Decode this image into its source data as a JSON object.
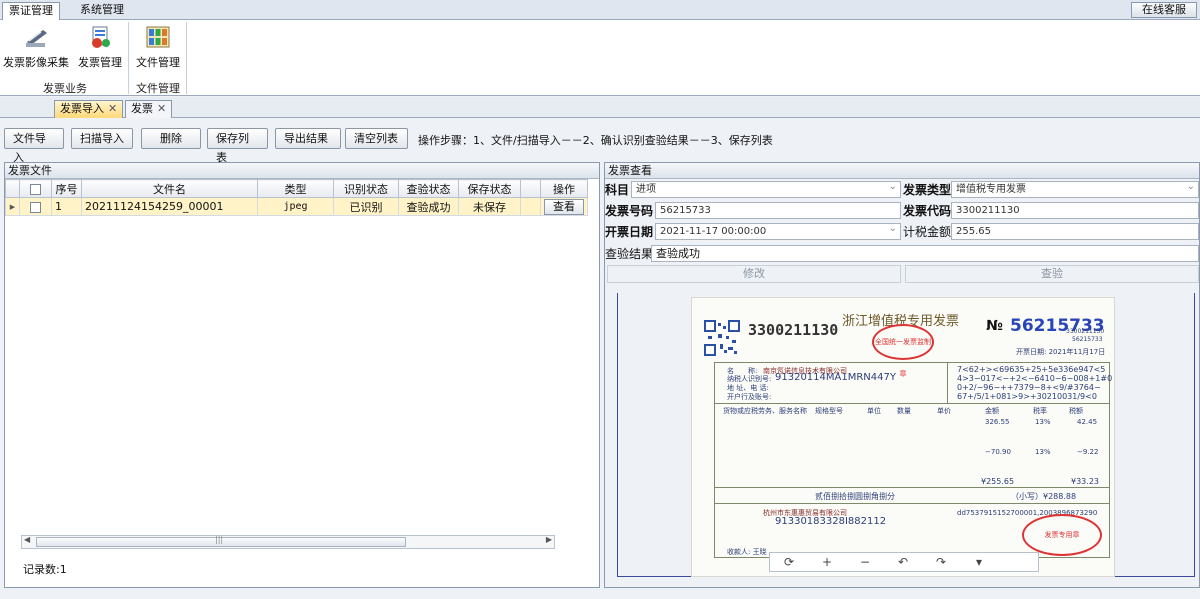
{
  "menu": {
    "tabs": [
      {
        "label": "票证管理"
      },
      {
        "label": "系统管理"
      }
    ],
    "online_service": "在线客服"
  },
  "ribbon": {
    "buttons": [
      {
        "label": "发票影像采集",
        "icon": "scanner-icon"
      },
      {
        "label": "发票管理",
        "icon": "invoice-manage-icon"
      },
      {
        "label": "文件管理",
        "icon": "file-manage-icon"
      }
    ],
    "groups": [
      {
        "label": "发票业务"
      },
      {
        "label": "文件管理"
      }
    ]
  },
  "doc_tabs": [
    {
      "label": "发票导入"
    },
    {
      "label": "发票"
    }
  ],
  "toolbar": {
    "buttons": [
      "文件导入",
      "扫描导入",
      "删除",
      "保存列表",
      "导出结果",
      "清空列表"
    ],
    "steps": "操作步骤：1、文件/扫描导入－－2、确认识别查验结果－－3、保存列表"
  },
  "left_panel": {
    "title": "发票文件",
    "columns": [
      "序号",
      "文件名",
      "类型",
      "识别状态",
      "查验状态",
      "保存状态",
      "操作"
    ],
    "rows": [
      {
        "index": "1",
        "filename": "20211124154259_00001",
        "type": "jpeg",
        "recog": "已识别",
        "check": "查验成功",
        "save": "未保存",
        "action": "查看"
      }
    ],
    "records": "记录数:1"
  },
  "right_panel": {
    "title": "发票查看",
    "fields": {
      "subject_label": "科目",
      "subject_value": "进项",
      "type_label": "发票类型",
      "type_value": "增值税专用发票",
      "number_label": "发票号码",
      "number_value": "56215733",
      "code_label": "发票代码",
      "code_value": "3300211130",
      "date_label": "开票日期",
      "date_value": "2021-11-17 00:00:00",
      "amount_label": "计税金额",
      "amount_value": "255.65",
      "result_label": "查验结果",
      "result_value": "查验成功"
    },
    "modify_btn": "修改",
    "check_btn": "查验"
  },
  "invoice": {
    "code": "3300211130",
    "title": "浙江增值税专用发票",
    "no_label": "№",
    "number": "56215733",
    "number_small": "3300211130",
    "number_small2": "56215733",
    "date": "开票日期:  2021年11月17日",
    "buyer_name": "南京氖诺信息技术有限公司",
    "buyer_tax_id": "91320114MA1MRN447Y",
    "cipher_1": "7<62+><69635+25+5e336e947<5",
    "cipher_2": "4>3−017<−+2<−6410−6−008+1#0",
    "cipher_3": "0+2/−96−++7379−8+<9/#3764−",
    "cipher_4": "67+/5/1+081>9>+30210031/9<0",
    "item_header": "货物或应税劳务、服务名称",
    "spec_header": "规格型号",
    "unit_header": "单位",
    "qty_header": "数量",
    "price_header": "单价",
    "amount_header": "金额",
    "rate_header": "税率",
    "tax_header": "税额",
    "line_amount": "326.55",
    "line_rate": "13%",
    "line_tax": "42.45",
    "discount_amount": "−70.90",
    "discount_rate": "13%",
    "discount_tax": "−9.22",
    "total_amount": "¥255.65",
    "total_tax": "¥33.23",
    "grand_text": "贰佰捌拾捌圆捌角捌分",
    "grand_small": "（小写）¥288.88",
    "seller_name": "杭州市东惠惠贸易有限公司",
    "seller_tax_id": "91330183328I882112",
    "remark": "dd7537915152700001,2003896873290",
    "payee": "收款人: 王晓"
  },
  "viewer_tools": [
    "rotate-icon",
    "zoom-in-icon",
    "zoom-out-icon",
    "undo-icon",
    "redo-icon",
    "dropdown-icon"
  ]
}
